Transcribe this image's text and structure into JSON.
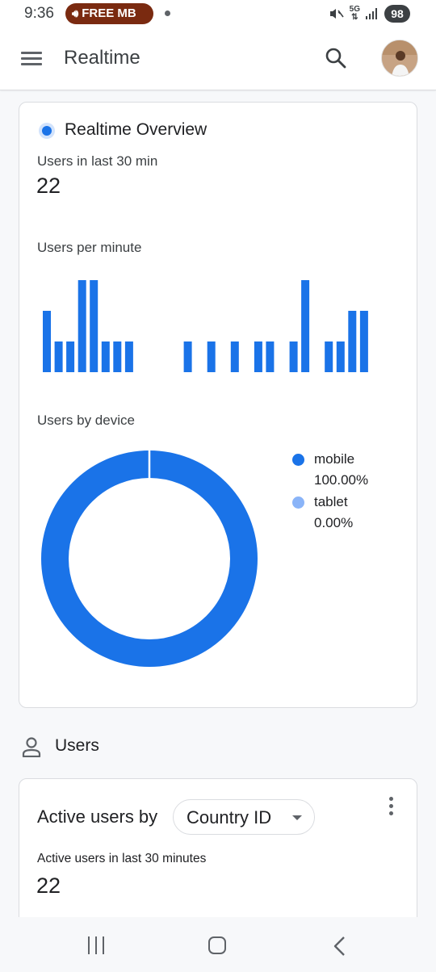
{
  "status_bar": {
    "time": "9:36",
    "free_pill": "FREE MB",
    "network": "5G",
    "battery": "98"
  },
  "app_bar": {
    "title": "Realtime",
    "icons": [
      "menu-icon",
      "search-icon",
      "avatar"
    ]
  },
  "overview": {
    "title": "Realtime Overview",
    "users_label": "Users in last 30 min",
    "users_value": "22",
    "per_minute_label": "Users per minute",
    "device_label": "Users by device"
  },
  "chart_data": [
    {
      "type": "bar",
      "values": [
        2,
        1,
        1,
        3,
        3,
        1,
        1,
        1,
        0,
        0,
        0,
        0,
        1,
        0,
        1,
        0,
        1,
        0,
        1,
        1,
        0,
        1,
        3,
        0,
        1,
        1,
        2,
        2
      ],
      "ylim": [
        0,
        3
      ],
      "grid": false,
      "color": "#1a73e8"
    },
    {
      "type": "pie",
      "categories": [
        "mobile",
        "tablet"
      ],
      "values": [
        100.0,
        0.0
      ],
      "labels": [
        "100.00%",
        "0.00%"
      ],
      "colors": [
        "#1a73e8",
        "#8ab4f8"
      ],
      "legend": "right",
      "donut": true
    }
  ],
  "legend": [
    {
      "name": "mobile",
      "pct": "100.00%",
      "color": "#1a73e8"
    },
    {
      "name": "tablet",
      "pct": "0.00%",
      "color": "#8ab4f8"
    }
  ],
  "users_section": {
    "title": "Users"
  },
  "active_card": {
    "title": "Active users by",
    "dimension": "Country ID",
    "label": "Active users in last 30 minutes",
    "value": "22"
  },
  "colors": {
    "accent": "#1a73e8",
    "accent_light": "#8ab4f8",
    "free_pill": "#7a2a10"
  }
}
